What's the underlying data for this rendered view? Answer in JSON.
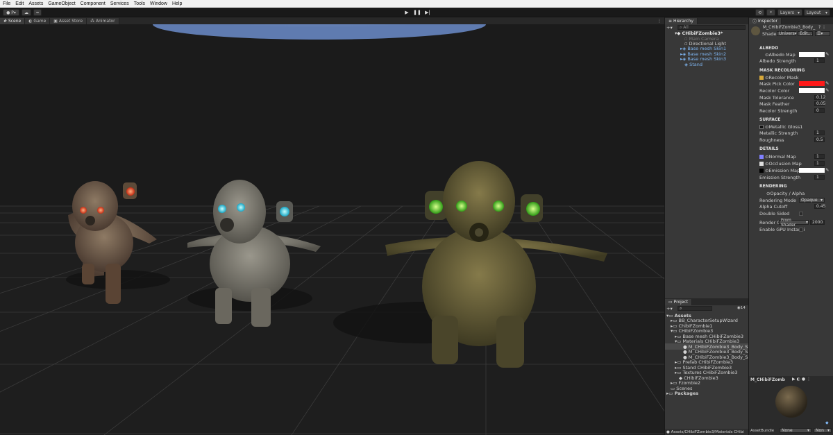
{
  "menubar": {
    "items": [
      "File",
      "Edit",
      "Assets",
      "GameObject",
      "Component",
      "Services",
      "Tools",
      "Window",
      "Help"
    ]
  },
  "toolbar": {
    "account": "P",
    "layers": "Layers",
    "layout": "Layout"
  },
  "scene_tabs": [
    {
      "label": "Scene",
      "active": true
    },
    {
      "label": "Game",
      "active": false
    },
    {
      "label": "Asset Store",
      "active": false
    },
    {
      "label": "Animator",
      "active": false
    }
  ],
  "hierarchy": {
    "title": "Hierarchy",
    "search": "All",
    "root": "CHibiFZombie3*",
    "items": [
      {
        "label": "Main Camera",
        "style": "dim"
      },
      {
        "label": "Directional Light",
        "style": "normal"
      },
      {
        "label": "Base mesh Skin1",
        "style": "prefab"
      },
      {
        "label": "Base mesh Skin2",
        "style": "prefab"
      },
      {
        "label": "Base mesh Skin3",
        "style": "prefab"
      },
      {
        "label": "Stand",
        "style": "prefab"
      }
    ]
  },
  "project": {
    "title": "Project",
    "count": "14",
    "tree": [
      {
        "label": "Assets",
        "bold": true
      },
      {
        "label": "BB_CharacterSetupWizard"
      },
      {
        "label": "ChibiFZombie1"
      },
      {
        "label": "CHibiFZombie3"
      },
      {
        "label": "Base mesh CHibiFZombie3"
      },
      {
        "label": "Materials CHibiFZombie3"
      },
      {
        "label": "M_CHibiFZombie3_Body_Skin1"
      },
      {
        "label": "M_CHibiFZombie3_Body_Skin2"
      },
      {
        "label": "M_CHibiFZombie3_Body_Skin3"
      },
      {
        "label": "Prefab CHibiFZombie3"
      },
      {
        "label": "Stand CHibiFZombie3"
      },
      {
        "label": "Textures CHibiFZombie3"
      },
      {
        "label": "CHibiFZombie3"
      },
      {
        "label": "Fzombie2"
      },
      {
        "label": "Scenes"
      },
      {
        "label": "Packages",
        "bold": true
      }
    ],
    "path": "Assets/CHibiFZombie3/Materials CHibi"
  },
  "inspector": {
    "title": "Inspector",
    "material_name": "M_CHibiFZombie3_Body_",
    "shader_label": "Shader",
    "shader_value": "Univers",
    "edit_label": "Edit...",
    "sections": {
      "albedo": "ALBEDO",
      "mask": "MASK RECOLORING",
      "surface": "SURFACE",
      "details": "DETAILS",
      "rendering": "RENDERING"
    },
    "props": {
      "albedo_map": "Albedo Map",
      "albedo_strength": "Albedo Strength",
      "albedo_strength_val": "1",
      "recolor_mask": "Recolor Mask",
      "mask_pick": "Mask Pick Color",
      "recolor_color": "Recolor Color",
      "mask_tol": "Mask Tolerance",
      "mask_tol_val": "0.12",
      "mask_feather": "Mask Feather",
      "mask_feather_val": "0.05",
      "recolor_strength": "Recolor Strength",
      "recolor_strength_val": "0",
      "metallic_gloss": "Metallic Gloss1",
      "metallic_strength": "Metallic Strength",
      "metallic_strength_val": "1",
      "roughness": "Roughness",
      "roughness_val": "0.5",
      "normal_map": "Normal Map",
      "normal_val": "1",
      "occlusion_map": "Occlusion Map",
      "occlusion_val": "1",
      "emission_map": "Emission Map",
      "emission_strength": "Emission Strength",
      "emission_strength_val": "1",
      "opacity": "Opacity / Alpha",
      "rendering_mode": "Rendering Mode",
      "rendering_mode_val": "Opaque",
      "alpha_cutoff": "Alpha Cutoff",
      "alpha_cutoff_val": "0.45",
      "double_sided": "Double Sided",
      "render_queue": "Render Q",
      "render_queue_src": "From Shader",
      "render_queue_val": "2000",
      "gpu_instancing": "Enable GPU Instanci"
    },
    "colors": {
      "mask_pick": "#ff1a1a",
      "albedo": "#ffffff",
      "recolor": "#ffffff",
      "emission": "#ffffff"
    }
  },
  "preview": {
    "name": "M_CHibiFZomb"
  },
  "assetbundle": {
    "label": "AssetBundle",
    "value1": "None",
    "value2": "Non"
  }
}
